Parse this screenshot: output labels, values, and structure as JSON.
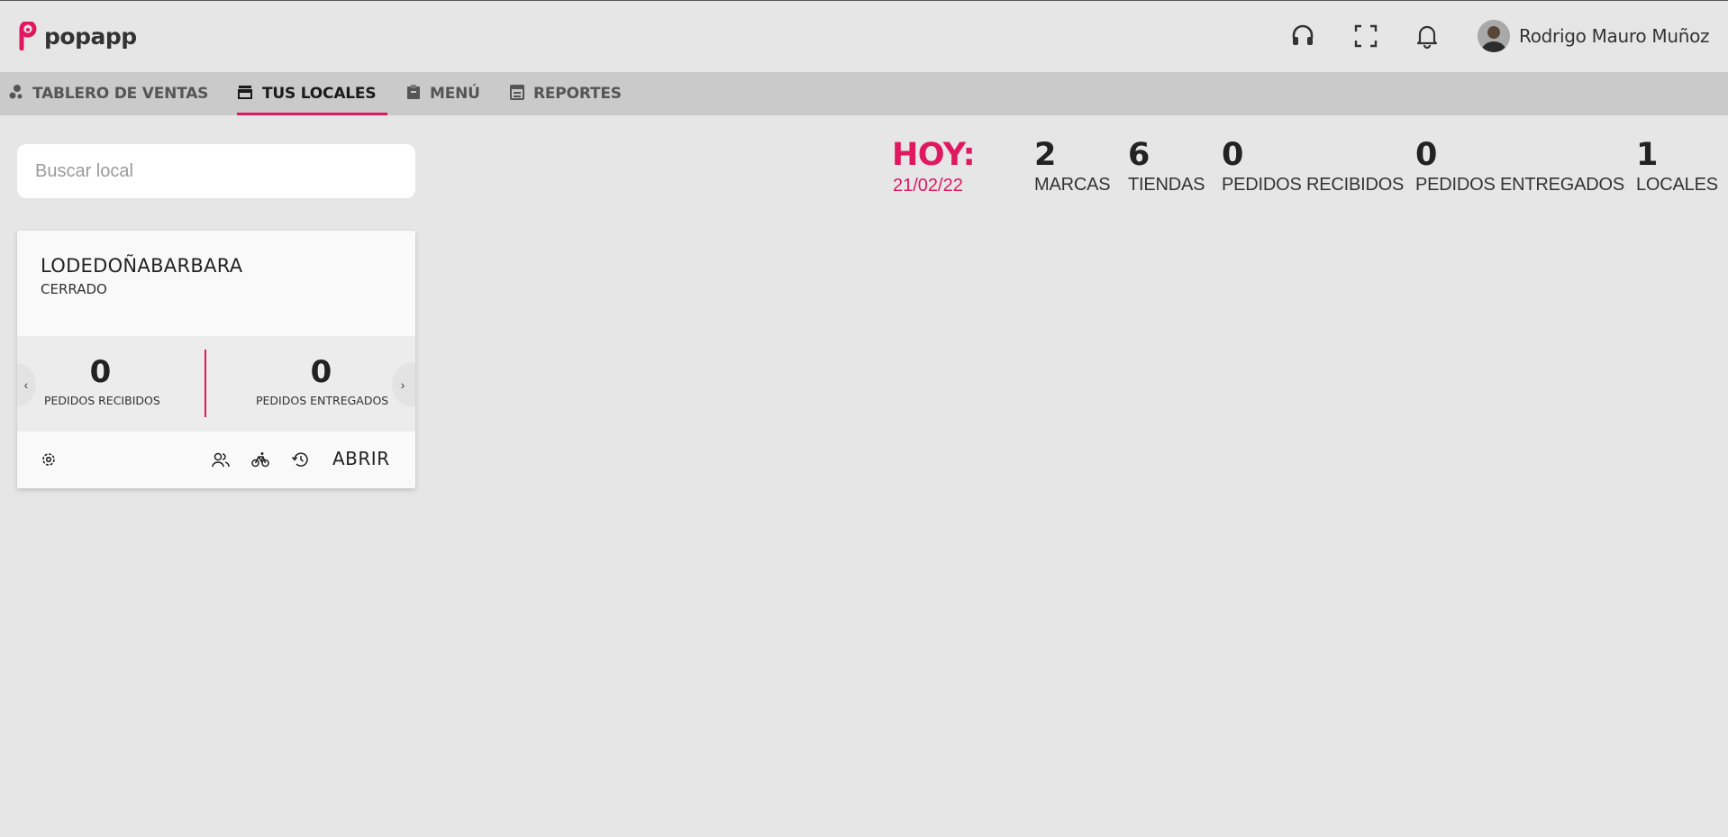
{
  "app": {
    "logo_text": "popapp"
  },
  "header": {
    "icons": [
      "headset-icon",
      "fullscreen-icon",
      "bell-icon"
    ],
    "user_name": "Rodrigo Mauro Muñoz"
  },
  "nav": [
    {
      "label": "TABLERO DE VENTAS",
      "icon": "dashboard-icon",
      "active": false
    },
    {
      "label": "TUS LOCALES",
      "icon": "store-icon",
      "active": true
    },
    {
      "label": "MENÚ",
      "icon": "clipboard-icon",
      "active": false
    },
    {
      "label": "REPORTES",
      "icon": "report-icon",
      "active": false
    }
  ],
  "search": {
    "placeholder": "Buscar local",
    "value": ""
  },
  "today": {
    "label": "HOY:",
    "date": "21/02/22",
    "stats": [
      {
        "value": "2",
        "label": "MARCAS"
      },
      {
        "value": "6",
        "label": "TIENDAS"
      },
      {
        "value": "0",
        "label": "PEDIDOS RECIBIDOS"
      },
      {
        "value": "0",
        "label": "PEDIDOS ENTREGADOS"
      },
      {
        "value": "1",
        "label": "LOCALES"
      }
    ]
  },
  "locales": [
    {
      "name": "LODEDOÑABARBARA",
      "status": "CERRADO",
      "stats": [
        {
          "value": "0",
          "label": "PEDIDOS RECIBIDOS"
        },
        {
          "value": "0",
          "label": "PEDIDOS ENTREGADOS"
        }
      ],
      "prev_arrow": "‹",
      "next_arrow": "›",
      "action_label": "ABRIR",
      "icons": [
        "settings-icon",
        "users-icon",
        "bike-icon",
        "history-icon"
      ]
    }
  ],
  "colors": {
    "accent": "#e0185f",
    "background": "#e6e6e6",
    "navbar": "#cacaca"
  }
}
